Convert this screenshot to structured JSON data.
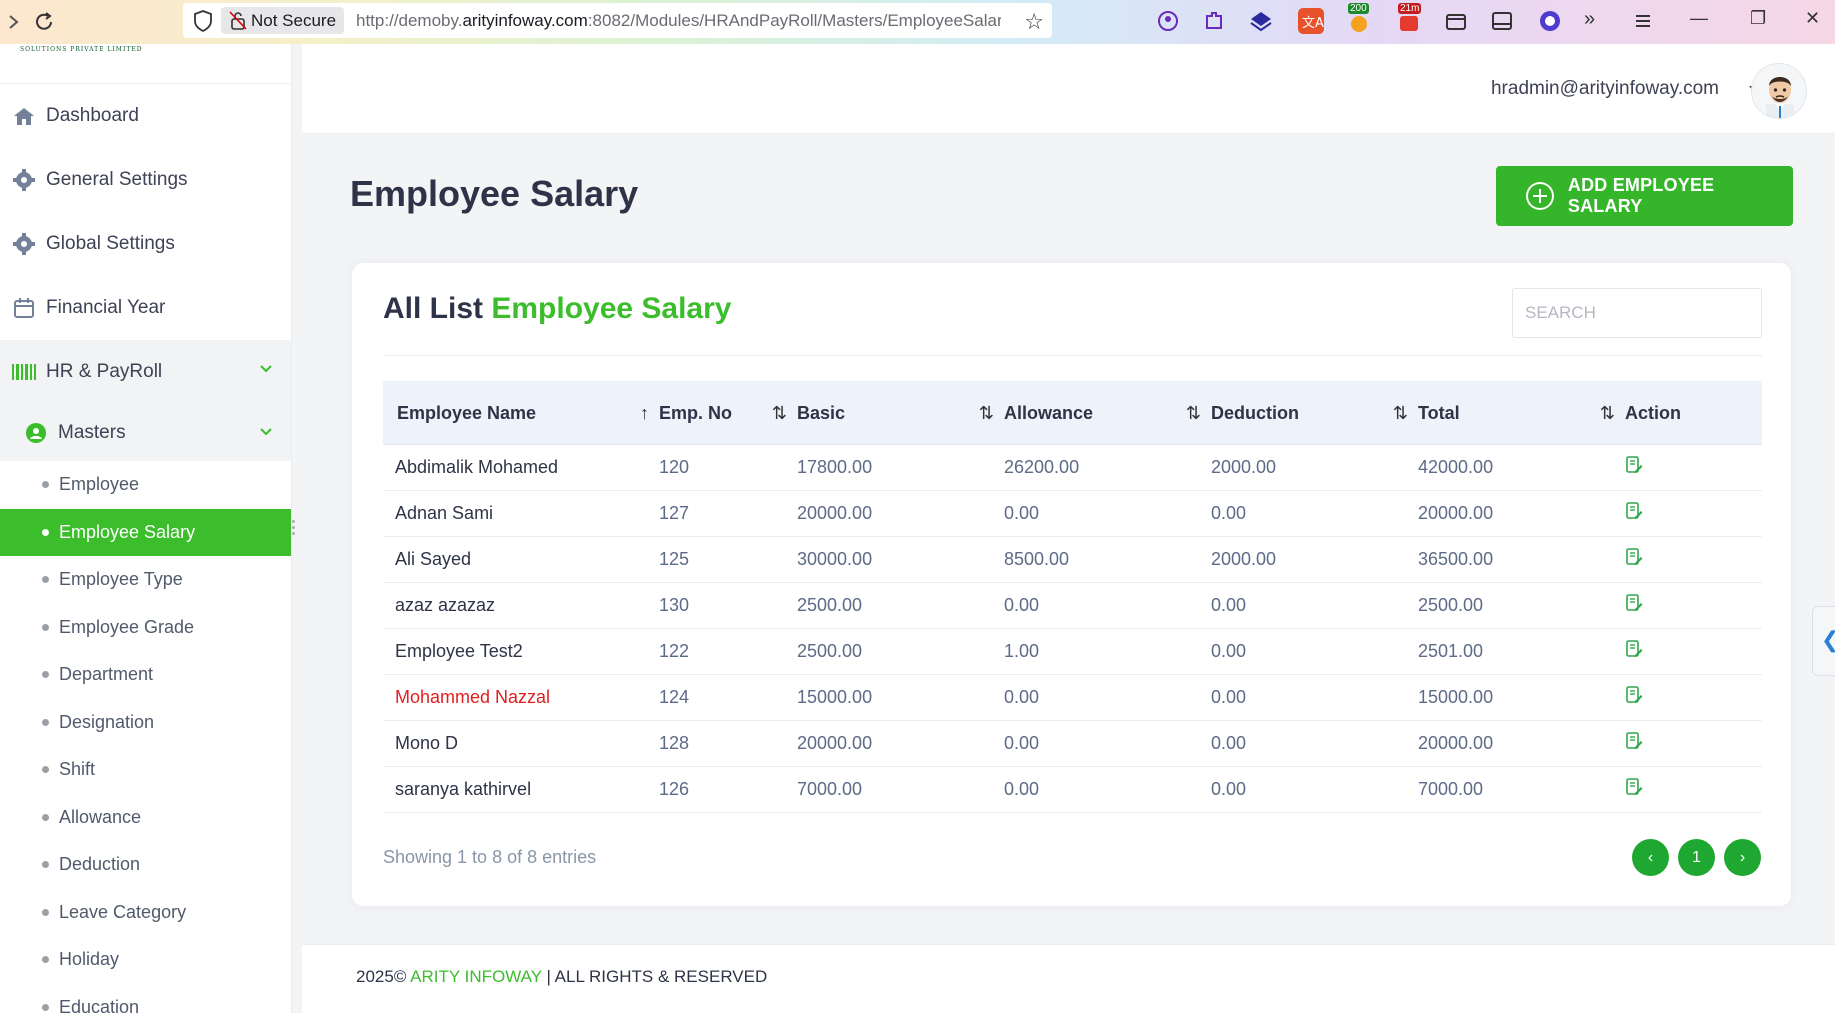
{
  "browser": {
    "security_label": "Not Secure",
    "url_prefix": "http://demoby.",
    "url_domain": "arityinfoway.com",
    "url_suffix": ":8082/Modules/HRAndPayRoll/Masters/EmployeeSalar",
    "ext_badge_1": "200",
    "ext_badge_2": "21m"
  },
  "sidebar": {
    "logo_text": "SOLUTIONS PRIVATE LIMITED",
    "items": [
      {
        "label": "Dashboard",
        "icon": "home-icon"
      },
      {
        "label": "General Settings",
        "icon": "gear-icon"
      },
      {
        "label": "Global Settings",
        "icon": "gear-icon"
      },
      {
        "label": "Financial Year",
        "icon": "calendar-icon"
      },
      {
        "label": "HR & PayRoll",
        "icon": "barcode-icon"
      }
    ],
    "masters_label": "Masters",
    "submenu": [
      {
        "label": "Employee"
      },
      {
        "label": "Employee Salary"
      },
      {
        "label": "Employee Type"
      },
      {
        "label": "Employee Grade"
      },
      {
        "label": "Department"
      },
      {
        "label": "Designation"
      },
      {
        "label": "Shift"
      },
      {
        "label": "Allowance"
      },
      {
        "label": "Deduction"
      },
      {
        "label": "Leave Category"
      },
      {
        "label": "Holiday"
      },
      {
        "label": "Education"
      }
    ],
    "accent_color": "#3cbd2c"
  },
  "header": {
    "user_email": "hradmin@arityinfoway.com"
  },
  "page": {
    "title": "Employee Salary",
    "add_button_label": "ADD EMPLOYEE SALARY"
  },
  "card": {
    "title_prefix": "All List ",
    "title_highlight": "Employee Salary",
    "search_placeholder": "SEARCH"
  },
  "table": {
    "columns": [
      "Employee Name",
      "Emp. No",
      "Basic",
      "Allowance",
      "Deduction",
      "Total",
      "Action"
    ],
    "rows": [
      {
        "name": "Abdimalik Mohamed",
        "emp_no": "120",
        "basic": "17800.00",
        "allowance": "26200.00",
        "deduction": "2000.00",
        "total": "42000.00"
      },
      {
        "name": "Adnan Sami",
        "emp_no": "127",
        "basic": "20000.00",
        "allowance": "0.00",
        "deduction": "0.00",
        "total": "20000.00"
      },
      {
        "name": "Ali Sayed",
        "emp_no": "125",
        "basic": "30000.00",
        "allowance": "8500.00",
        "deduction": "2000.00",
        "total": "36500.00"
      },
      {
        "name": "azaz azazaz",
        "emp_no": "130",
        "basic": "2500.00",
        "allowance": "0.00",
        "deduction": "0.00",
        "total": "2500.00"
      },
      {
        "name": "Employee Test2",
        "emp_no": "122",
        "basic": "2500.00",
        "allowance": "1.00",
        "deduction": "0.00",
        "total": "2501.00"
      },
      {
        "name": "Mohammed Nazzal",
        "emp_no": "124",
        "basic": "15000.00",
        "allowance": "0.00",
        "deduction": "0.00",
        "total": "15000.00"
      },
      {
        "name": "Mono D",
        "emp_no": "128",
        "basic": "20000.00",
        "allowance": "0.00",
        "deduction": "0.00",
        "total": "20000.00"
      },
      {
        "name": "saranya kathirvel",
        "emp_no": "126",
        "basic": "7000.00",
        "allowance": "0.00",
        "deduction": "0.00",
        "total": "7000.00"
      }
    ],
    "showing_text": "Showing 1 to 8 of 8 entries",
    "current_page": "1"
  },
  "footer": {
    "prefix": "2025© ",
    "brand": "ARITY INFOWAY",
    "suffix": " | ALL RIGHTS & RESERVED"
  }
}
